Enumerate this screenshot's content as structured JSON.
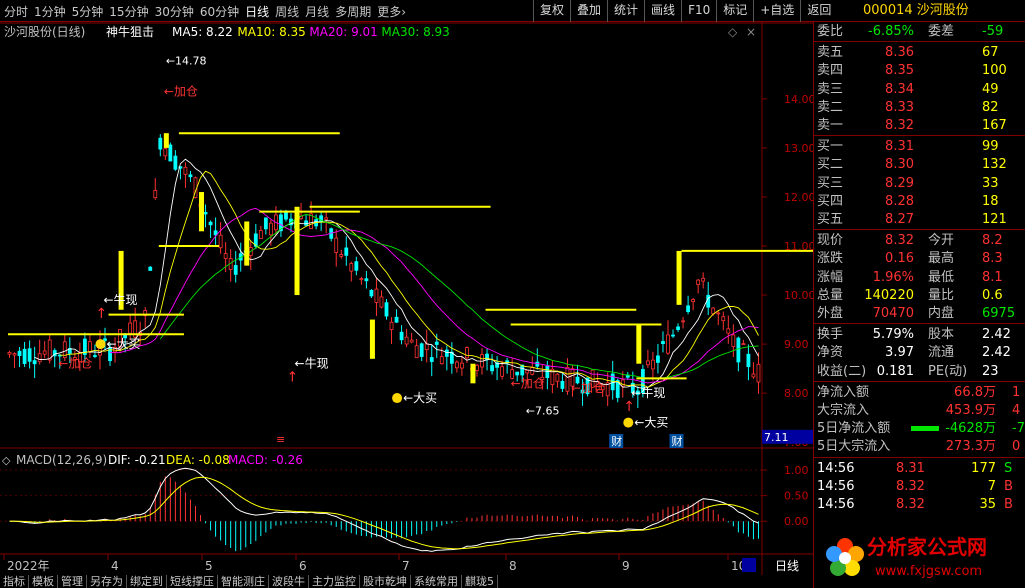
{
  "topbar": {
    "tabs": [
      "分时",
      "1分钟",
      "5分钟",
      "15分钟",
      "30分钟",
      "60分钟",
      "日线",
      "周线",
      "月线",
      "多周期",
      "更多›"
    ],
    "active_tab": "日线",
    "buttons": [
      "复权",
      "叠加",
      "统计",
      "画线",
      "F10",
      "标记",
      "+自选",
      "返回"
    ],
    "stock": "000014 沙河股份"
  },
  "chart": {
    "title": "沙河股份(日线)",
    "indicator": "神牛狙击",
    "ma": [
      {
        "label": "MA5: 8.22",
        "color": "#ffffff"
      },
      {
        "label": "MA10: 8.35",
        "color": "#ffff00"
      },
      {
        "label": "MA20: 9.01",
        "color": "#ff00ff"
      },
      {
        "label": "MA30: 8.93",
        "color": "#00e600"
      }
    ],
    "yaxis": [
      "14.00",
      "13.00",
      "12.00",
      "11.00",
      "10.00",
      "9.00",
      "8.00",
      "7.00"
    ],
    "current_price": "7.11",
    "high_label": "14.78",
    "low_label": "7.65",
    "annotations": [
      "加仓",
      "加仓",
      "牛现",
      "大买",
      "牛现",
      "大买",
      "牛现",
      "加仓",
      "加仓",
      "大买",
      "牛现",
      "大买"
    ],
    "markers": [
      "财",
      "财"
    ],
    "xaxis": [
      "2022年",
      "4",
      "5",
      "6",
      "7",
      "8",
      "9",
      "10"
    ],
    "macd": {
      "title": "MACD(12,26,9)",
      "dif": "DIF: -0.21",
      "dea": "DEA: -0.08",
      "macd": "MACD: -0.26",
      "yaxis": [
        "1.00",
        "0.50",
        "0.00"
      ]
    },
    "period_label": "日线"
  },
  "chart_data": {
    "type": "line",
    "title": "沙河股份(日线)",
    "ylabel": "",
    "ylim": [
      6.8,
      15.2
    ],
    "x": [
      "2022-3",
      "2022-4",
      "2022-5",
      "2022-6",
      "2022-7",
      "2022-8",
      "2022-9",
      "2022-10"
    ],
    "series": [
      {
        "name": "MA5",
        "values": [
          8.9,
          12.8,
          10.9,
          8.6,
          8.5,
          7.9,
          9.1,
          8.22
        ]
      },
      {
        "name": "MA10",
        "values": [
          8.8,
          12.0,
          11.2,
          8.9,
          8.6,
          8.0,
          8.9,
          8.35
        ]
      },
      {
        "name": "MA20",
        "values": [
          8.6,
          10.9,
          11.4,
          9.6,
          8.7,
          8.2,
          8.6,
          9.01
        ]
      },
      {
        "name": "MA30",
        "values": [
          8.5,
          10.0,
          11.0,
          9.9,
          8.9,
          8.3,
          8.5,
          8.93
        ]
      }
    ]
  },
  "quote": {
    "weibi_label": "委比",
    "weibi": "-6.85%",
    "weicha_label": "委差",
    "weicha": "-59",
    "asks": [
      {
        "label": "卖五",
        "price": "8.36",
        "vol": "67"
      },
      {
        "label": "卖四",
        "price": "8.35",
        "vol": "100"
      },
      {
        "label": "卖三",
        "price": "8.34",
        "vol": "49"
      },
      {
        "label": "卖二",
        "price": "8.33",
        "vol": "82"
      },
      {
        "label": "卖一",
        "price": "8.32",
        "vol": "167"
      }
    ],
    "bids": [
      {
        "label": "买一",
        "price": "8.31",
        "vol": "99"
      },
      {
        "label": "买二",
        "price": "8.30",
        "vol": "132"
      },
      {
        "label": "买三",
        "price": "8.29",
        "vol": "33"
      },
      {
        "label": "买四",
        "price": "8.28",
        "vol": "18"
      },
      {
        "label": "买五",
        "price": "8.27",
        "vol": "121"
      }
    ],
    "stats": [
      {
        "l": "现价",
        "v": "8.32",
        "vc": "red",
        "l2": "今开",
        "v2": "8.2",
        "v2c": "red"
      },
      {
        "l": "涨跌",
        "v": "0.16",
        "vc": "red",
        "l2": "最高",
        "v2": "8.3",
        "v2c": "red"
      },
      {
        "l": "涨幅",
        "v": "1.96%",
        "vc": "red",
        "l2": "最低",
        "v2": "8.1",
        "v2c": "red"
      },
      {
        "l": "总量",
        "v": "140220",
        "vc": "yellow",
        "l2": "量比",
        "v2": "0.6",
        "v2c": "yellow"
      },
      {
        "l": "外盘",
        "v": "70470",
        "vc": "red",
        "l2": "内盘",
        "v2": "6975",
        "v2c": "green"
      }
    ],
    "stats2": [
      {
        "l": "换手",
        "v": "5.79%",
        "vc": "white",
        "l2": "股本",
        "v2": "2.42",
        "v2c": "white"
      },
      {
        "l": "净资",
        "v": "3.97",
        "vc": "white",
        "l2": "流通",
        "v2": "2.42",
        "v2c": "white"
      },
      {
        "l": "收益(二)",
        "v": "0.181",
        "vc": "white",
        "l2": "PE(动)",
        "v2": "23",
        "v2c": "white"
      }
    ],
    "flows": [
      {
        "l": "净流入额",
        "v": "66.8万",
        "vc": "red",
        "x": "1"
      },
      {
        "l": "大宗流入",
        "v": "453.9万",
        "vc": "red",
        "x": "4"
      },
      {
        "l": "5日净流入额",
        "v": "-4628万",
        "vc": "green",
        "x": "-7"
      },
      {
        "l": "5日大宗流入",
        "v": "273.3万",
        "vc": "red",
        "x": "0"
      }
    ],
    "ticks": [
      {
        "t": "14:56",
        "p": "8.31",
        "v": "177",
        "s": "S"
      },
      {
        "t": "14:56",
        "p": "8.32",
        "v": "7",
        "s": "B"
      },
      {
        "t": "14:56",
        "p": "8.32",
        "v": "35",
        "s": "B"
      }
    ]
  },
  "bottombar": [
    "指标",
    "模板",
    "管理",
    "另存为",
    "绑定到",
    "短线撑压",
    "智能测庄",
    "波段牛",
    "主力监控",
    "股市乾坤",
    "系统常用",
    "麒珑5"
  ],
  "logo": {
    "text": "分析家公式网",
    "url_text": "www.fxjgsw.com"
  }
}
